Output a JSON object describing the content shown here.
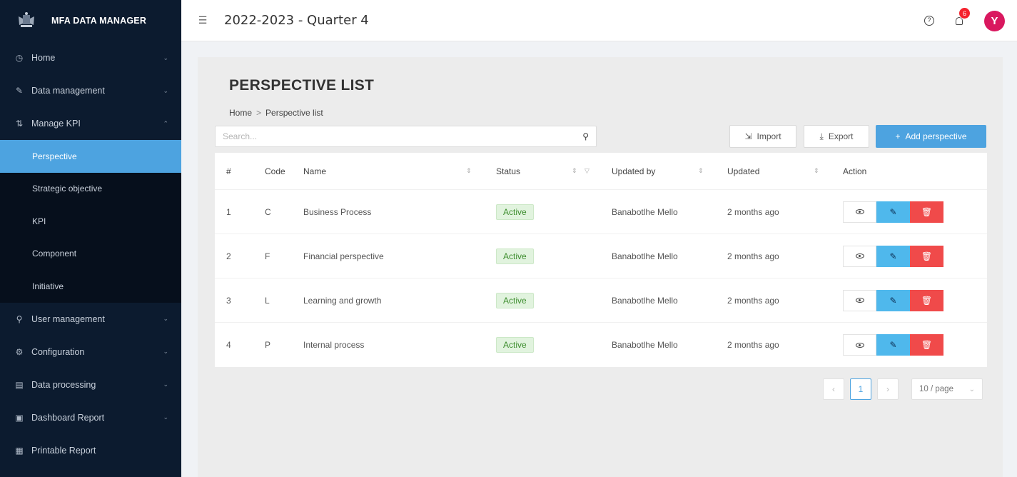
{
  "app": {
    "title": "MFA DATA MANAGER"
  },
  "header": {
    "period": "2022-2023 - Quarter 4",
    "notification_count": "6",
    "avatar_initial": "Y"
  },
  "sidebar": {
    "items": [
      {
        "label": "Home",
        "icon": "clock-icon"
      },
      {
        "label": "Data management",
        "icon": "edit-icon"
      },
      {
        "label": "Manage KPI",
        "icon": "chart-icon"
      },
      {
        "label": "User management",
        "icon": "user-icon"
      },
      {
        "label": "Configuration",
        "icon": "gear-icon"
      },
      {
        "label": "Data processing",
        "icon": "table-icon"
      },
      {
        "label": "Dashboard Report",
        "icon": "report-icon"
      },
      {
        "label": "Printable Report",
        "icon": "print-report-icon"
      }
    ],
    "submenu": [
      "Perspective",
      "Strategic objective",
      "KPI",
      "Component",
      "Initiative"
    ]
  },
  "page": {
    "title": "PERSPECTIVE LIST",
    "breadcrumb": [
      "Home",
      "Perspective list"
    ],
    "search_placeholder": "Search...",
    "import_label": "Import",
    "export_label": "Export",
    "add_label": "Add perspective"
  },
  "table": {
    "headers": [
      "#",
      "Code",
      "Name",
      "Status",
      "Updated by",
      "Updated",
      "Action"
    ],
    "rows": [
      {
        "no": "1",
        "code": "C",
        "name": "Business Process",
        "status": "Active",
        "updated_by": "Banabotlhe Mello",
        "updated": "2 months ago"
      },
      {
        "no": "2",
        "code": "F",
        "name": "Financial perspective",
        "status": "Active",
        "updated_by": "Banabotlhe Mello",
        "updated": "2 months ago"
      },
      {
        "no": "3",
        "code": "L",
        "name": "Learning and growth",
        "status": "Active",
        "updated_by": "Banabotlhe Mello",
        "updated": "2 months ago"
      },
      {
        "no": "4",
        "code": "P",
        "name": "Internal process",
        "status": "Active",
        "updated_by": "Banabotlhe Mello",
        "updated": "2 months ago"
      }
    ]
  },
  "pagination": {
    "current": "1",
    "page_size": "10 / page"
  },
  "colors": {
    "sidebar_bg": "#0c1b2f",
    "accent": "#4da3e0",
    "edit": "#4fb8ec",
    "delete": "#f04a4a",
    "active_tag": "#e1f3de",
    "avatar": "#d9185f"
  }
}
